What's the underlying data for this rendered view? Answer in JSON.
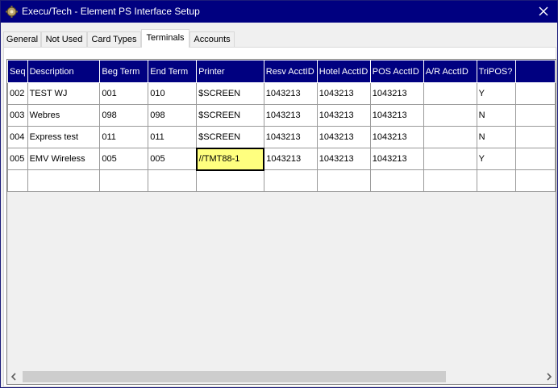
{
  "window": {
    "title": "Execu/Tech - Element PS Interface Setup",
    "titlebar_color": "#000080"
  },
  "tabs": [
    {
      "label": "General"
    },
    {
      "label": "Not Used"
    },
    {
      "label": "Card Types"
    },
    {
      "label": "Terminals",
      "active": true
    },
    {
      "label": "Accounts"
    }
  ],
  "table": {
    "columns": [
      "Seq",
      "Description",
      "Beg Term",
      "End Term",
      "Printer",
      "Resv AcctID",
      "Hotel AcctID",
      "POS AcctID",
      "A/R AcctID",
      "TriPOS?",
      ""
    ],
    "rows": [
      [
        "002",
        "TEST WJ",
        "001",
        "010",
        "$SCREEN",
        "1043213",
        "1043213",
        "1043213",
        "",
        "Y",
        ""
      ],
      [
        "003",
        "Webres",
        "098",
        "098",
        "$SCREEN",
        "1043213",
        "1043213",
        "1043213",
        "",
        "N",
        ""
      ],
      [
        "004",
        "Express test",
        "011",
        "011",
        "$SCREEN",
        "1043213",
        "1043213",
        "1043213",
        "",
        "N",
        ""
      ],
      [
        "005",
        "EMV Wireless",
        "005",
        "005",
        "//TMT88-1",
        "1043213",
        "1043213",
        "1043213",
        "",
        "Y",
        ""
      ],
      [
        "",
        "",
        "",
        "",
        "",
        "",
        "",
        "",
        "",
        "",
        ""
      ]
    ],
    "selected_cell": {
      "row": 3,
      "col": 4
    },
    "header_color": "#000080",
    "selected_color": "#ffff7f"
  },
  "icons": {
    "app": "app-gear-icon",
    "close": "close-icon",
    "scroll_left": "chevron-left-icon",
    "scroll_right": "chevron-right-icon"
  }
}
